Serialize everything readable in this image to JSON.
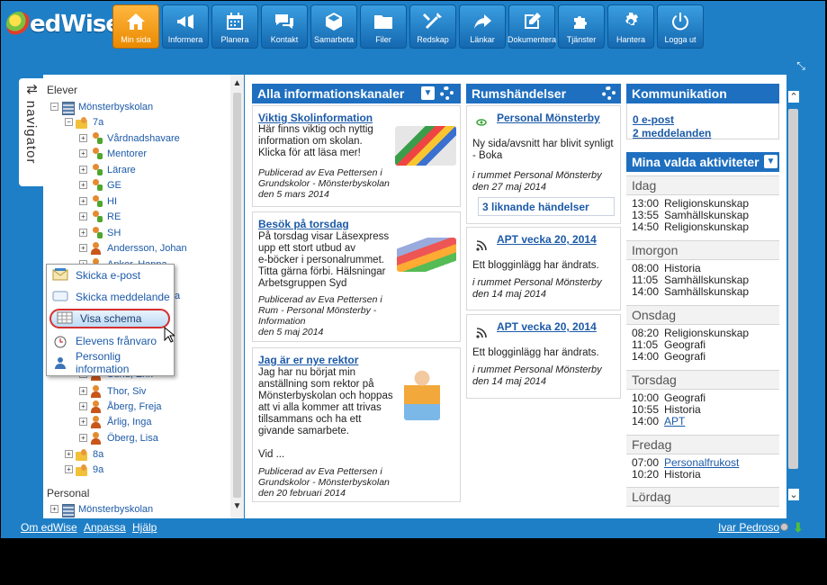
{
  "app": {
    "name": "edWise"
  },
  "toolbar": [
    {
      "label": "Min sida",
      "icon": "home-icon",
      "active": true
    },
    {
      "label": "Informera",
      "icon": "megaphone-icon"
    },
    {
      "label": "Planera",
      "icon": "calendar-icon"
    },
    {
      "label": "Kontakt",
      "icon": "chat-icon"
    },
    {
      "label": "Samarbeta",
      "icon": "cube-icon"
    },
    {
      "label": "Filer",
      "icon": "folder-icon"
    },
    {
      "label": "Redskap",
      "icon": "tools-icon"
    },
    {
      "label": "Länkar",
      "icon": "arrow-icon"
    },
    {
      "label": "Dokumentera",
      "icon": "pencil-icon"
    },
    {
      "label": "Tjänster",
      "icon": "puzzle-icon"
    },
    {
      "label": "Hantera",
      "icon": "gear-icon"
    },
    {
      "label": "Logga ut",
      "icon": "power-icon"
    }
  ],
  "navigator": {
    "label": "navigator",
    "arrow": "⇅"
  },
  "tree": {
    "elever_label": "Elever",
    "school": "Mönsterbyskolan",
    "class_7a": "7a",
    "groups": [
      "Vårdnadshavare",
      "Mentorer",
      "Lärare",
      "GE",
      "HI",
      "RE",
      "SH"
    ],
    "students_top": [
      "Andersson, Johan",
      "Anker, Hanna"
    ],
    "students_hidden_fragment": "a",
    "students_partial": "Sund, Erik",
    "students_bottom": [
      "Thor, Siv",
      "Åberg, Freja",
      "Årlig, Inga",
      "Öberg, Lisa"
    ],
    "class_8a": "8a",
    "class_9a": "9a",
    "personal_label": "Personal",
    "personal_school": "Mönsterbyskolan"
  },
  "context_menu": [
    {
      "label": "Skicka e-post",
      "icon": "envelope-icon"
    },
    {
      "label": "Skicka meddelande",
      "icon": "message-icon"
    },
    {
      "label": "Visa schema",
      "icon": "schedule-icon",
      "highlighted": true
    },
    {
      "label": "Elevens frånvaro",
      "icon": "clock-icon"
    },
    {
      "label": "Personlig information",
      "icon": "person-info-icon"
    }
  ],
  "info_panel": {
    "title": "Alla informationskanaler",
    "posts": [
      {
        "title": "Viktig Skolinformation",
        "body": [
          "Här finns viktig och nyttig",
          "information om skolan.",
          "Klicka för att läsa mer!"
        ],
        "meta": [
          "Publicerad av Eva Pettersen i",
          "Grundskolor - Mönsterbyskolan",
          "den 5 mars 2014"
        ]
      },
      {
        "title": "Besök på torsdag",
        "body": [
          "På torsdag visar Läsexpress",
          "upp ett stort utbud av",
          "e-böcker i personalrummet.",
          "Titta gärna förbi. Hälsningar",
          "Arbetsgruppen Syd"
        ],
        "meta": [
          "Publicerad av Eva Pettersen i",
          "Rum - Personal Mönsterby -",
          "Information",
          "den 5 maj 2014"
        ]
      },
      {
        "title": "Jag är er nye rektor",
        "body": [
          "Jag har nu börjat min",
          "anställning som rektor på",
          "Mönsterbyskolan och hoppas",
          "att vi alla kommer att trivas",
          "tillsammans och ha ett",
          "givande samarbete.",
          "",
          "Vid ..."
        ],
        "meta": [
          "Publicerad av Eva Pettersen i",
          "Grundskolor - Mönsterbyskolan",
          "den 20 februari 2014"
        ]
      }
    ]
  },
  "room_panel": {
    "title": "Rumshändelser",
    "events": [
      {
        "link": "Personal Mönsterby",
        "text": [
          "Ny sida/avsnitt har blivit synligt",
          "- Boka"
        ],
        "meta": [
          "i rummet Personal Mönsterby",
          "den 27 maj 2014"
        ],
        "similar": "3 liknande händelser"
      },
      {
        "link": "APT vecka 20, 2014",
        "text": [
          "Ett blogginlägg har ändrats."
        ],
        "meta": [
          "i rummet Personal Mönsterby",
          "den 14 maj 2014"
        ]
      },
      {
        "link": "APT vecka 20, 2014",
        "text": [
          "Ett blogginlägg har ändrats."
        ],
        "meta": [
          "i rummet Personal Mönsterby",
          "den 14 maj 2014"
        ]
      }
    ]
  },
  "comm_panel": {
    "title": "Kommunikation",
    "links": [
      "0 e-post",
      "2 meddelanden"
    ]
  },
  "activities_panel": {
    "title": "Mina valda aktiviteter",
    "days": [
      {
        "day": "Idag",
        "items": [
          [
            "13:00",
            "Religionskunskap"
          ],
          [
            "13:55",
            "Samhällskunskap"
          ],
          [
            "14:50",
            "Religionskunskap"
          ]
        ]
      },
      {
        "day": "Imorgon",
        "items": [
          [
            "08:00",
            "Historia"
          ],
          [
            "11:05",
            "Samhällskunskap"
          ],
          [
            "14:00",
            "Samhällskunskap"
          ]
        ]
      },
      {
        "day": "Onsdag",
        "items": [
          [
            "08:20",
            "Religionskunskap"
          ],
          [
            "11:05",
            "Geografi"
          ],
          [
            "14:00",
            "Geografi"
          ]
        ]
      },
      {
        "day": "Torsdag",
        "items": [
          [
            "10:00",
            "Geografi"
          ],
          [
            "10:55",
            "Historia"
          ],
          [
            "14:00",
            "APT",
            "link"
          ]
        ]
      },
      {
        "day": "Fredag",
        "items": [
          [
            "07:00",
            "Personalfrukost",
            "link"
          ],
          [
            "10:20",
            "Historia"
          ]
        ]
      },
      {
        "day": "Lördag",
        "items": []
      }
    ]
  },
  "footer": {
    "links": [
      "Om edWise",
      "Anpassa",
      "Hjälp"
    ],
    "user": "Ivar Pedroso"
  },
  "colors": {
    "brand_blue": "#1e7fc6",
    "panel_header": "#1e6fc0",
    "active_tab": "#f5a623",
    "highlight_ring": "#d43030"
  }
}
